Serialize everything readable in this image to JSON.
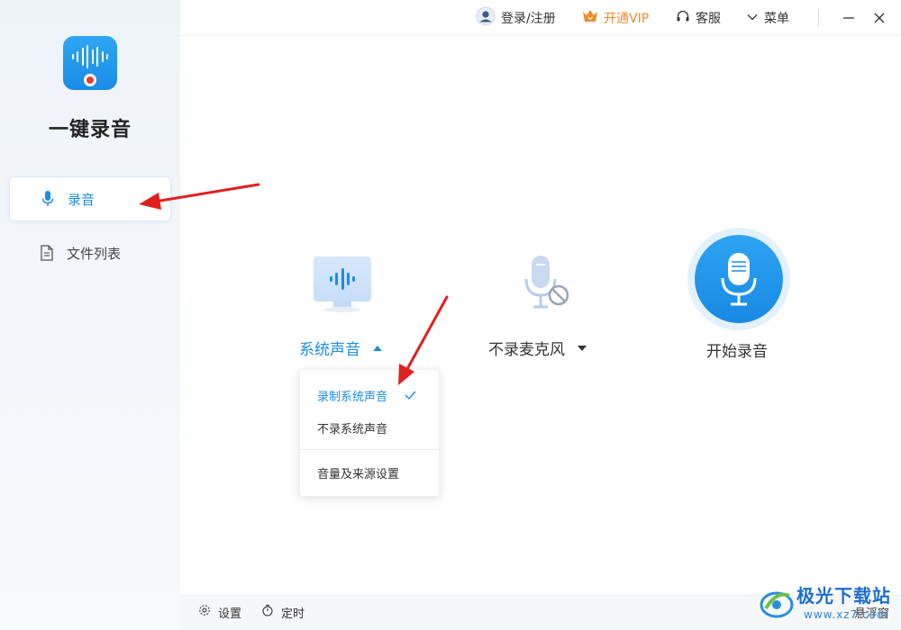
{
  "app": {
    "name": "一键录音"
  },
  "sidebar": {
    "items": [
      {
        "label": "录音",
        "icon": "microphone-icon",
        "active": true
      },
      {
        "label": "文件列表",
        "icon": "document-icon",
        "active": false
      }
    ]
  },
  "topbar": {
    "login": "登录/注册",
    "vip": "开通VIP",
    "service": "客服",
    "menu": "菜单"
  },
  "main": {
    "system_sound": {
      "label": "系统声音",
      "icon": "monitor-sound-icon"
    },
    "microphone": {
      "label": "不录麦克风",
      "icon": "microphone-off-icon"
    },
    "start": {
      "label": "开始录音",
      "icon": "microphone-icon"
    }
  },
  "dropdown": {
    "items": [
      {
        "label": "录制系统声音",
        "selected": true
      },
      {
        "label": "不录系统声音",
        "selected": false
      },
      {
        "label": "音量及来源设置",
        "selected": false
      }
    ]
  },
  "bottombar": {
    "settings": "设置",
    "timer": "定时",
    "float_window": "悬浮窗"
  },
  "watermark": {
    "title": "极光下载站",
    "url": "www.xz7.com"
  },
  "colors": {
    "accent": "#1a8ce6",
    "vip": "#ef8b2c",
    "annotation": "#e02020"
  }
}
